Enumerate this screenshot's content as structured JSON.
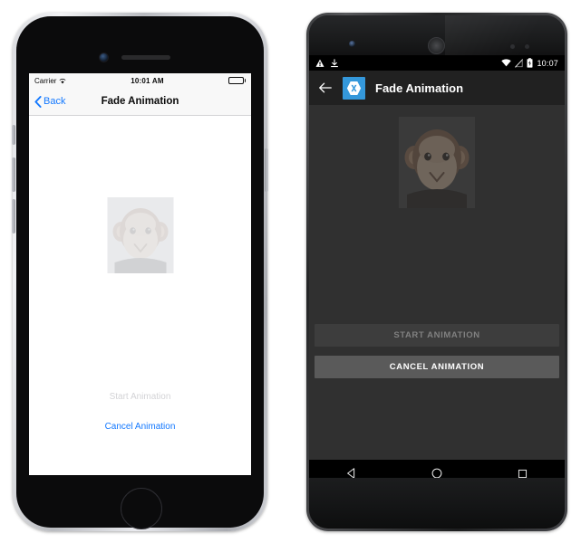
{
  "page": {
    "background": "#ffffff",
    "title": "Fade Animation cross-platform comparison"
  },
  "ios": {
    "device": "iphone",
    "status_bar": {
      "carrier": "Carrier",
      "wifi_icon": "wifi-icon",
      "time": "10:01 AM",
      "battery_icon": "battery-full-icon"
    },
    "nav_bar": {
      "back_icon": "chevron-left-icon",
      "back_label": "Back",
      "title": "Fade Animation",
      "tint_color": "#1479ff",
      "background": "#f8f8f8"
    },
    "content": {
      "image_name": "monkey-image",
      "image_alt": "Monkey",
      "image_opacity": "0.12"
    },
    "buttons": {
      "start_label": "Start Animation",
      "start_enabled": false,
      "start_color": "#d3d3d6",
      "cancel_label": "Cancel Animation",
      "cancel_enabled": true,
      "cancel_color": "#1479ff"
    },
    "hardware": {
      "camera_icon": "front-camera-icon",
      "speaker_icon": "earpiece-speaker-icon",
      "home_button_icon": "home-button-icon"
    }
  },
  "android": {
    "device": "nexus",
    "status_bar": {
      "warning_icon": "warning-triangle-icon",
      "download_icon": "download-icon",
      "wifi_icon": "wifi-icon",
      "signal_icon": "signal-off-icon",
      "battery_icon": "battery-charging-icon",
      "time": "10:07",
      "background": "#000000"
    },
    "toolbar": {
      "back_icon": "arrow-back-icon",
      "app_logo_icon": "xamarin-logo-icon",
      "logo_background": "#3498db",
      "title": "Fade Animation",
      "background": "#212121"
    },
    "content": {
      "background": "#303030",
      "image_name": "monkey-image",
      "image_alt": "Monkey",
      "image_opacity": "0.30"
    },
    "buttons": {
      "start_label": "START ANIMATION",
      "start_enabled": false,
      "start_background": "#3d3d3d",
      "start_color": "#808080",
      "cancel_label": "CANCEL ANIMATION",
      "cancel_enabled": true,
      "cancel_background": "#5a5a5a",
      "cancel_color": "#ffffff"
    },
    "nav_bar": {
      "back_icon": "nav-back-triangle-icon",
      "home_icon": "nav-home-circle-icon",
      "recents_icon": "nav-recents-square-icon",
      "background": "#000000"
    },
    "hardware": {
      "camera_icon": "front-camera-icon",
      "speaker_icon": "earpiece-speaker-icon",
      "sensor_icon": "proximity-sensor-icon"
    }
  }
}
